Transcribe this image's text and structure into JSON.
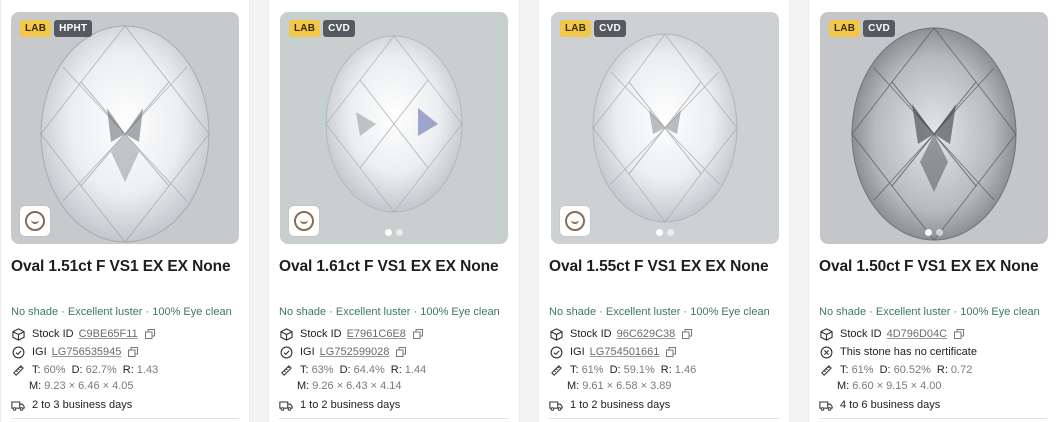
{
  "cards": [
    {
      "lab_badge": "LAB",
      "type_badge": "HPHT",
      "title": "Oval 1.51ct F VS1 EX EX None",
      "quality": "No shade · Excellent luster · 100% Eye clean",
      "stock_label": "Stock ID",
      "stock_id": "C9BE65F11",
      "cert_label": "IGI",
      "cert_id": "LG756535945",
      "t_label": "T:",
      "t_value": "60%",
      "d_label": "D:",
      "d_value": "62.7%",
      "r_label": "R:",
      "r_value": "1.43",
      "m_label": "M:",
      "m_value": "9.23 × 6.46 × 4.05",
      "shipping": "2 to 3 business days"
    },
    {
      "lab_badge": "LAB",
      "type_badge": "CVD",
      "title": "Oval 1.61ct F VS1 EX EX None",
      "quality": "No shade · Excellent luster · 100% Eye clean",
      "stock_label": "Stock ID",
      "stock_id": "E7961C6E8",
      "cert_label": "IGI",
      "cert_id": "LG752599028",
      "t_label": "T:",
      "t_value": "63%",
      "d_label": "D:",
      "d_value": "64.4%",
      "r_label": "R:",
      "r_value": "1.44",
      "m_label": "M:",
      "m_value": "9.26 × 6.43 × 4.14",
      "shipping": "1 to 2 business days"
    },
    {
      "lab_badge": "LAB",
      "type_badge": "CVD",
      "title": "Oval 1.55ct F VS1 EX EX None",
      "quality": "No shade · Excellent luster · 100% Eye clean",
      "stock_label": "Stock ID",
      "stock_id": "96C629C38",
      "cert_label": "IGI",
      "cert_id": "LG754501661",
      "t_label": "T:",
      "t_value": "61%",
      "d_label": "D:",
      "d_value": "59.1%",
      "r_label": "R:",
      "r_value": "1.46",
      "m_label": "M:",
      "m_value": "9.61 × 6.58 × 3.89",
      "shipping": "1 to 2 business days"
    },
    {
      "lab_badge": "LAB",
      "type_badge": "CVD",
      "title": "Oval 1.50ct F VS1 EX EX None",
      "quality": "No shade · Excellent luster · 100% Eye clean",
      "stock_label": "Stock ID",
      "stock_id": "4D796D04C",
      "cert_text": "This stone has no certificate",
      "t_label": "T:",
      "t_value": "61%",
      "d_label": "D:",
      "d_value": "60.52%",
      "r_label": "R:",
      "r_value": "0.72",
      "m_label": "M:",
      "m_value": "6.60 × 9.15 × 4.00",
      "shipping": "4 to 6 business days"
    }
  ],
  "colors": {
    "badge_lab": "#f2c84b",
    "badge_type": "#555a60",
    "quality_text": "#3c7a5c"
  },
  "icons": [
    "box-icon",
    "certificate-check-icon",
    "ruler-icon",
    "truck-icon",
    "copy-icon",
    "no-certificate-icon"
  ]
}
